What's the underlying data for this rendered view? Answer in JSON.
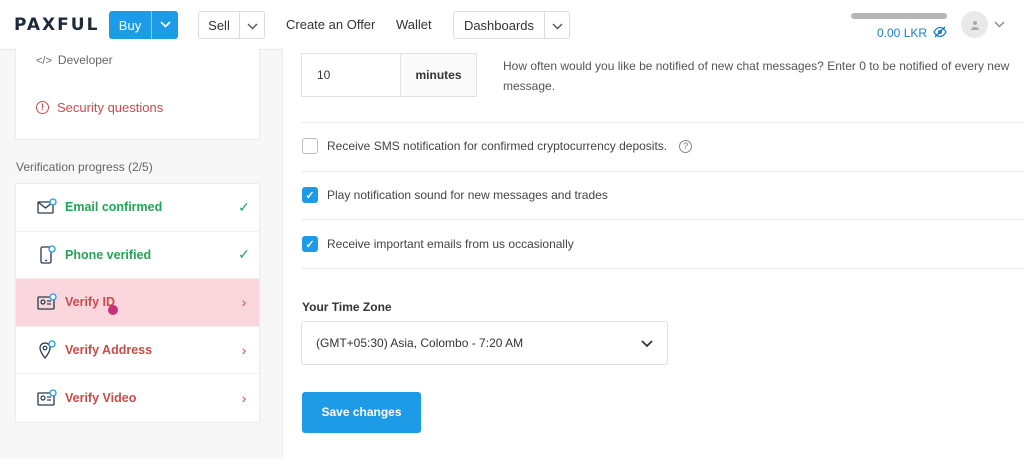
{
  "header": {
    "logo": "PAXFUL",
    "buy_label": "Buy",
    "sell_label": "Sell",
    "create_offer_label": "Create an Offer",
    "wallet_label": "Wallet",
    "dashboards_label": "Dashboards",
    "balance": "0.00 LKR",
    "icons": {
      "chevron": "chevron-down-icon",
      "hide_balance": "eye-off-icon",
      "avatar": "user-icon"
    }
  },
  "sidebar": {
    "developer_label": "Developer",
    "developer_icon_glyph": "</>",
    "security_label": "Security questions",
    "verification_title": "Verification progress (2/5)",
    "items": [
      {
        "label": "Email confirmed",
        "status": "done",
        "icon": "envelope-icon",
        "mark": "✓"
      },
      {
        "label": "Phone verified",
        "status": "done",
        "icon": "phone-icon",
        "mark": "✓"
      },
      {
        "label": "Verify ID",
        "status": "todo",
        "icon": "id-card-icon",
        "mark": "›"
      },
      {
        "label": "Verify Address",
        "status": "todo",
        "icon": "location-pin-icon",
        "mark": "›"
      },
      {
        "label": "Verify Video",
        "status": "todo",
        "icon": "video-id-icon",
        "mark": "›"
      }
    ]
  },
  "main": {
    "chat_interval_value": "10",
    "chat_interval_unit": "minutes",
    "chat_interval_desc": "How often would you like be notified of new chat messages? Enter 0 to be notified of every new message.",
    "options": [
      {
        "label": "Receive SMS notification for confirmed cryptocurrency deposits.",
        "checked": false
      },
      {
        "label": "Play notification sound for new messages and trades",
        "checked": true
      },
      {
        "label": "Receive important emails from us occasionally",
        "checked": true
      }
    ],
    "timezone_label": "Your Time Zone",
    "timezone_value": "(GMT+05:30) Asia, Colombo - 7:20 AM",
    "save_label": "Save changes"
  },
  "colors": {
    "accent": "#1d9be6",
    "success": "#23a455",
    "danger": "#c94b4b",
    "active_row": "#fbd6dc"
  }
}
